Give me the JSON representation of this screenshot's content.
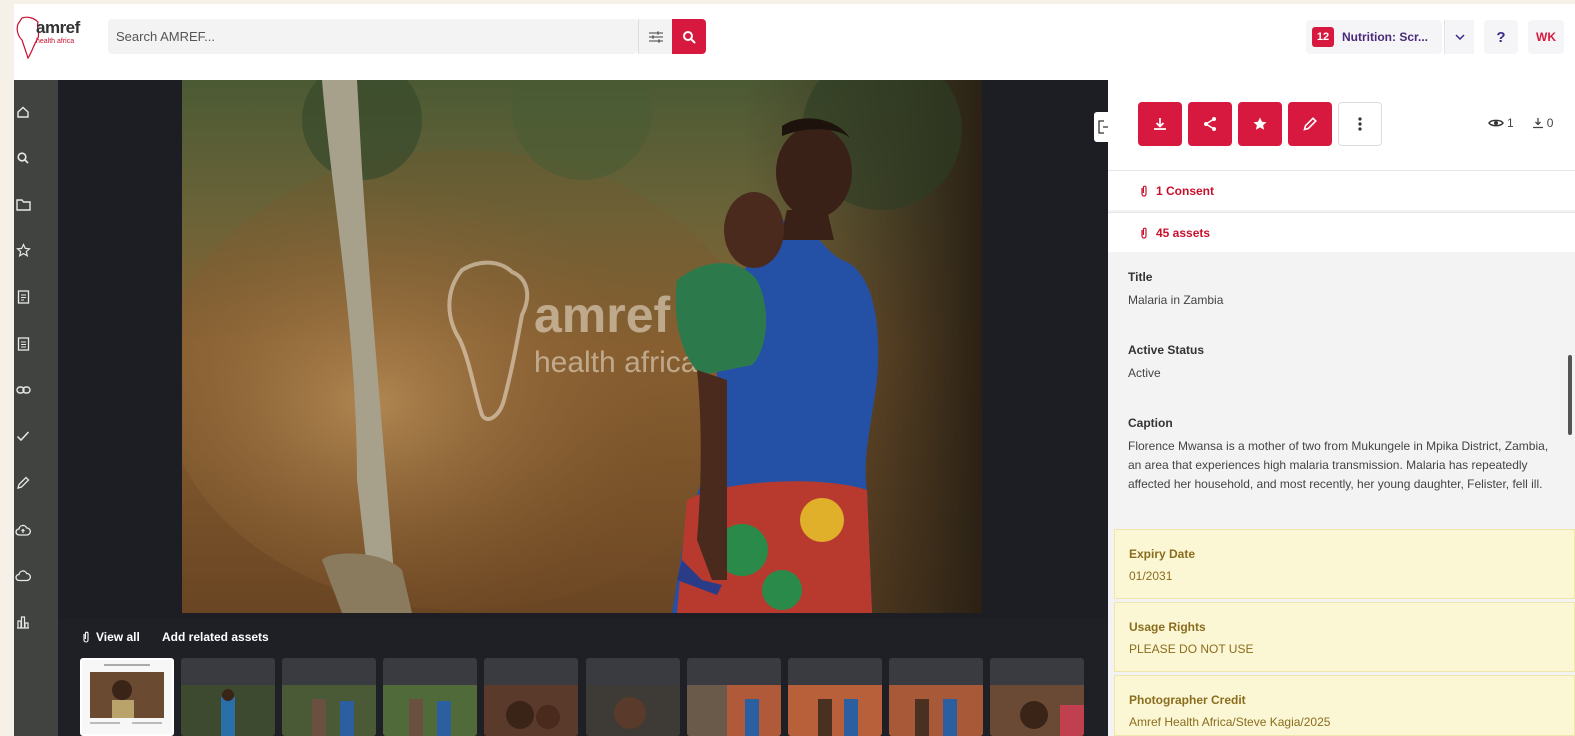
{
  "brand": {
    "name": "amref",
    "tagline": "health africa",
    "accent": "#d7193f"
  },
  "search": {
    "placeholder": "Search AMREF..."
  },
  "header": {
    "collection_count": "12",
    "collection_label": "Nutrition: Scr...",
    "help_label": "?",
    "user_initials": "WK"
  },
  "sidebar": {
    "items": [
      "home-icon",
      "search-icon",
      "folder-icon",
      "star-icon",
      "document-icon",
      "document-alt-icon",
      "link-icon",
      "check-icon",
      "pencil-icon",
      "cloud-upload-icon",
      "cloud-icon",
      "bar-chart-icon"
    ]
  },
  "viewer": {
    "watermark_top": "amref",
    "watermark_bottom": "health africa",
    "view_all": "View all",
    "add_related": "Add related assets"
  },
  "panel": {
    "stats": {
      "views": "1",
      "downloads": "0"
    },
    "consent": "1 Consent",
    "assets": "45 assets",
    "fields": [
      {
        "label": "Title",
        "value": "Malaria in Zambia"
      },
      {
        "label": "Active Status",
        "value": "Active"
      },
      {
        "label": "Caption",
        "value": "Florence Mwansa is a mother of two from Mukungele in Mpika District, Zambia, an area that experiences high malaria transmission. Malaria has repeatedly affected her household, and most recently, her young daughter, Felister, fell ill."
      }
    ],
    "highlighted": [
      {
        "label": "Expiry Date",
        "value": "01/2031"
      },
      {
        "label": "Usage Rights",
        "value": "PLEASE DO NOT USE"
      },
      {
        "label": "Photographer Credit",
        "value": "Amref Health Africa/Steve Kagia/2025"
      }
    ]
  }
}
